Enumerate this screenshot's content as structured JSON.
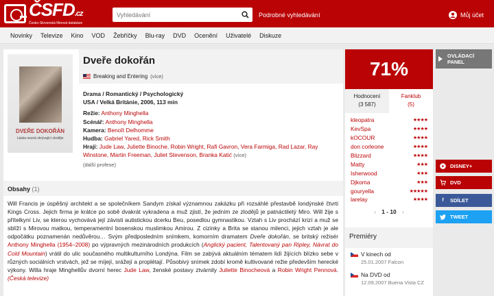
{
  "header": {
    "logo_text": "ČSFD",
    "logo_suffix": ".cz",
    "logo_sub": "Česko-Slovenská filmová databáze",
    "search_placeholder": "Vyhledávání",
    "advanced_search": "Podrobné vyhledávání",
    "user_label": "Můj účet"
  },
  "nav": [
    "Novinky",
    "Televize",
    "Kino",
    "VOD",
    "Žebříčky",
    "Blu-ray",
    "DVD",
    "Ocenění",
    "Uživatelé",
    "Diskuze"
  ],
  "film": {
    "title": "Dveře dokořán",
    "alt_title": "Breaking and Entering",
    "alt_more": "(více)",
    "poster_title": "DVEŘE DOKOŘÁN",
    "poster_sub": "Láska nezná skrývající zloděje",
    "genre": "Drama / Romantický / Psychologický",
    "origin": "USA / Velká Británie, 2006, 113 min",
    "director_label": "Režie:",
    "director": "Anthony Minghella",
    "screenplay_label": "Scénář:",
    "screenplay": "Anthony Minghella",
    "camera_label": "Kamera:",
    "camera": "Benoît Delhomme",
    "music_label": "Hudba:",
    "music": "Gabriel Yared, Rick Smith",
    "cast_label": "Hrají:",
    "cast": "Jude Law, Juliette Binoche, Robin Wright, Rafi Gavron, Vera Farmiga, Rad Lazar, Ray Winstone, Martin Freeman, Juliet Stevenson, Branka Katić",
    "cast_more": "(více)",
    "more_profiles": "(další profese)"
  },
  "plot": {
    "heading": "Obsahy",
    "count": "(1)",
    "p1": "Will Francis je úspěšný architekt a se společníkem Sandym získal významnou zakázku při rozsáhlé přestavbě londýnské čtvrti Kings Cross. Jejich firma je krátce po sobě dvakrát vykradena a muž zjistí, že jedním ze zlodějů je patnáctiletý Miro. Will žije s přítelkyní Liv, se kterou vychovává její závisti autistickou dcerku Beu, posedlou gymnastikou. Vztah s Liv prochází krizí a muž se sblíží s Mirovou matkou, temperamentní bosenskou muslimkou Amirou. Z cizinky a Brita se stanou milenci, jejich vztah je ale odpočátku poznamenán nedůvěrou… Svým předposledním snímkem, komorním dramatem ",
    "film_italic": "Dveře dokořán",
    "p2": ", se britský režisér ",
    "director_link": "Anthony Minghella (1954–2008)",
    "p3": " po výpravných mezinárodních produkcích (",
    "works": "Anglický pacient, Talentovaný pan Ripley, Návrat do Cold Mountain",
    "p4": ") vrátil do ulic současného multikulturního Londýna. Film se zabývá aktuálním tématem lidí žijících blízko sebe v různých sociálních vrstvách, jež se míjejí, srážejí a proplétají. Působivý snímek zdobí kromě kultivované režie především herecké výkony. Willa hraje Minghellův dvorní herec ",
    "actor1": "Jude Law",
    "p5": ", ženské postavy ztvárnily ",
    "actor2": "Juliette Binocheová",
    "p6": " a ",
    "actor3": "Robin Wright Pennová",
    "p7": ". ",
    "source": "(Česká televize)"
  },
  "rating": {
    "value": "71%",
    "tab1_label": "Hodnocení",
    "tab1_count": "(3 587)",
    "tab2_label": "Fanklub",
    "tab2_count": "(5)",
    "color": "#ba0305"
  },
  "fans": [
    {
      "name": "kleopatra",
      "stars": "★★★★"
    },
    {
      "name": "KevSpa",
      "stars": "★★★★"
    },
    {
      "name": "kOCOUR",
      "stars": "★★★★"
    },
    {
      "name": "don corleone",
      "stars": "★★★★"
    },
    {
      "name": "Blizzard",
      "stars": "★★★★"
    },
    {
      "name": "Matty",
      "stars": "★★★"
    },
    {
      "name": "Isherwood",
      "stars": "★★★"
    },
    {
      "name": "Djkoma",
      "stars": "★★★"
    },
    {
      "name": "gouryella",
      "stars": "★★★★★"
    },
    {
      "name": "larelay",
      "stars": "★★★★"
    }
  ],
  "pager": {
    "prev": "‹",
    "range": "1 - 10",
    "next": "›"
  },
  "premieres": {
    "heading": "Premiéry",
    "items": [
      {
        "label": "V kinech od",
        "date": "25.01.2007 Falcon"
      },
      {
        "label": "Na DVD od",
        "date": "12.09.2007 Buena Vista CZ"
      }
    ]
  },
  "right": {
    "panel": "OVLÁDACÍ PANEL",
    "disney": "DISNEY+",
    "dvd": "DVD",
    "share": "SDÍLET",
    "tweet": "TWEET"
  }
}
